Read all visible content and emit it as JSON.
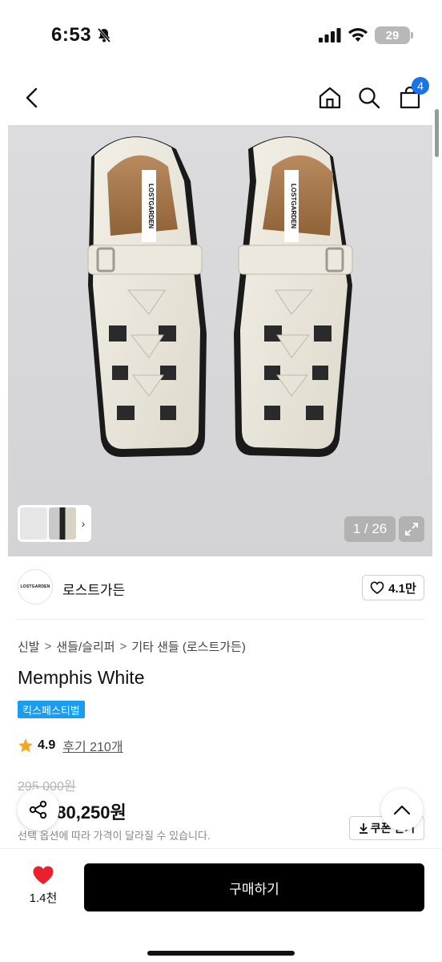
{
  "status_bar": {
    "time": "6:53",
    "battery": "29"
  },
  "nav": {
    "cart_count": "4"
  },
  "gallery": {
    "counter": "1 / 26",
    "brand_on_label": "LOSTGARDEN"
  },
  "brand": {
    "logo_text": "LOSTGARDEN",
    "name": "로스트가든",
    "likes": "4.1만"
  },
  "breadcrumb": {
    "items": [
      "신발",
      "샌들/슬리퍼",
      "기타 샌들 (로스트가든)"
    ],
    "separator": ">"
  },
  "product": {
    "title": "Memphis White",
    "badge": "킥스페스티벌",
    "rating": "4.9",
    "review_link": "후기 210개",
    "original_price": "295,000원",
    "sale_price": "280,250원",
    "price_note": "선택 옵션에 따라 가격이 달라질 수 있습니다.",
    "coupon_label": "쿠폰 받기"
  },
  "bottom_bar": {
    "wish_count": "1.4천",
    "buy_label": "구매하기"
  },
  "colors": {
    "accent": "#1a73e8",
    "badge": "#1a9cf0",
    "heart": "#e8212d",
    "star": "#f5a623"
  },
  "icons": [
    "back-icon",
    "home-icon",
    "search-icon",
    "cart-icon",
    "expand-icon",
    "heart-icon",
    "star-icon",
    "share-icon",
    "chevron-up-icon",
    "download-icon"
  ]
}
